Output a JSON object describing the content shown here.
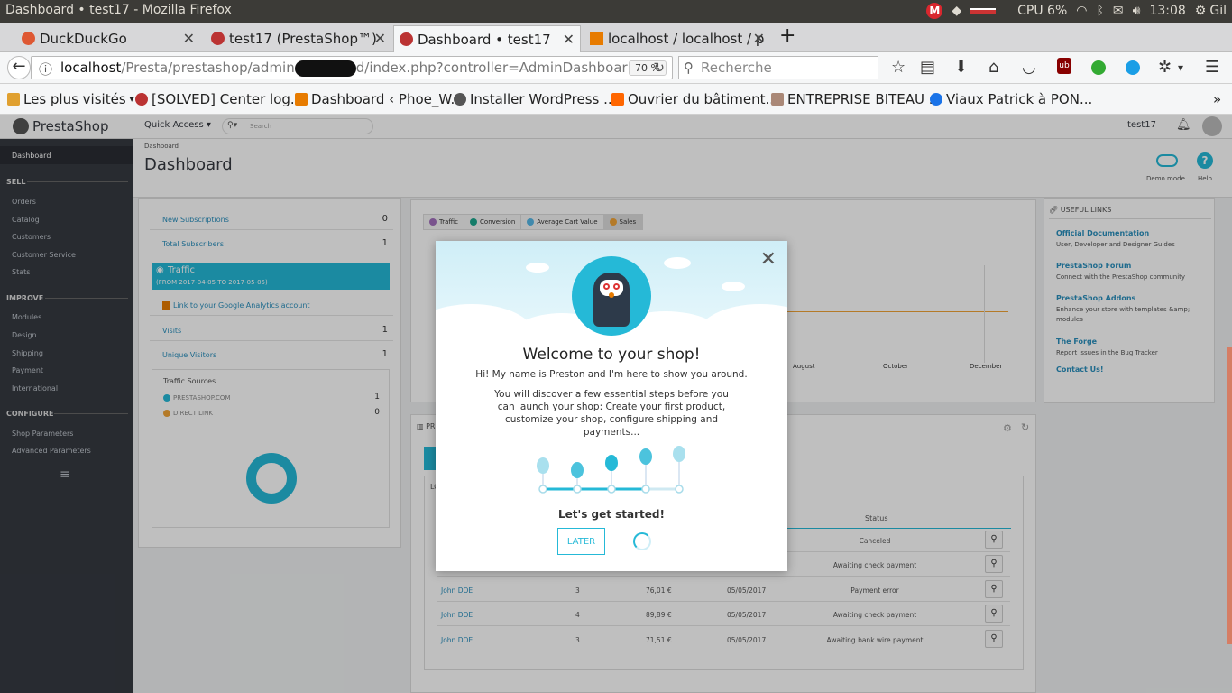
{
  "os": {
    "window_title": "Dashboard • test17 - Mozilla Firefox",
    "cpu": "CPU 6%",
    "clock": "13:08",
    "user": "Gil"
  },
  "tabs": [
    {
      "label": "DuckDuckGo",
      "favcolor": "#de5833"
    },
    {
      "label": "test17 (PrestaShop™)",
      "favcolor": "#b33"
    },
    {
      "label": "Dashboard • test17",
      "favcolor": "#b33"
    },
    {
      "label": "localhost / localhost / p",
      "favcolor": "#e77b00"
    }
  ],
  "nav": {
    "url_host": "localhost",
    "url_path": "/Presta/prestashop/admin",
    "url_tail": "d/index.php?controller=AdminDashboar",
    "zoom": "70 %",
    "search_placeholder": "Recherche"
  },
  "bookmarks": [
    {
      "label": "Les plus visités",
      "color": "#e0a030"
    },
    {
      "label": "[SOLVED] Center log...",
      "color": "#b33"
    },
    {
      "label": "Dashboard ‹ Phoe_W...",
      "color": "#e77b00"
    },
    {
      "label": "Installer WordPress ...",
      "color": "#555"
    },
    {
      "label": "Ouvrier du bâtiment...",
      "color": "#f60"
    },
    {
      "label": "ENTREPRISE BITEAU ...",
      "color": "#a87"
    },
    {
      "label": "Viaux Patrick à PON...",
      "color": "#1a73e8"
    }
  ],
  "ps": {
    "logo": "PrestaShop",
    "quick_access": "Quick Access",
    "search_placeholder": "Search",
    "user": "test17",
    "breadcrumb": "Dashboard",
    "page_title": "Dashboard",
    "demo_mode": "Demo mode",
    "help": "Help",
    "sidebar": {
      "dashboard": "Dashboard",
      "sell": "SELL",
      "sell_items": [
        "Orders",
        "Catalog",
        "Customers",
        "Customer Service",
        "Stats"
      ],
      "improve": "IMPROVE",
      "improve_items": [
        "Modules",
        "Design",
        "Shipping",
        "Payment",
        "International"
      ],
      "configure": "CONFIGURE",
      "configure_items": [
        "Shop Parameters",
        "Advanced Parameters"
      ]
    },
    "left_panel": {
      "new_subscriptions": "New Subscriptions",
      "new_subscriptions_val": "0",
      "total_subscribers": "Total Subscribers",
      "total_subscribers_val": "1",
      "traffic_title": "Traffic",
      "traffic_range": "(FROM 2017-04-05 TO 2017-05-05)",
      "ga_link": "Link to your Google Analytics account",
      "visits": "Visits",
      "visits_val": "1",
      "unique_visitors": "Unique Visitors",
      "unique_visitors_val": "1",
      "traffic_sources": "Traffic Sources",
      "src1": "PRESTASHOP.COM",
      "src1_val": "1",
      "src2": "DIRECT LINK",
      "src2_val": "0"
    },
    "chart_tabs": [
      "Traffic",
      "Conversion",
      "Average Cart Value",
      "Sales"
    ],
    "chart_tab_colors": [
      "#a26fbd",
      "#1ba68d",
      "#56b7e6",
      "#f0a336"
    ],
    "months": [
      "August",
      "October",
      "December"
    ],
    "useful_links": {
      "title": "USEFUL LINKS",
      "items": [
        {
          "title": "Official Documentation",
          "desc": "User, Developer and Designer Guides"
        },
        {
          "title": "PrestaShop Forum",
          "desc": "Connect with the PrestaShop community"
        },
        {
          "title": "PrestaShop Addons",
          "desc": "Enhance your store with templates &amp; modules"
        },
        {
          "title": "The Forge",
          "desc": "Report issues in the Bug Tracker"
        },
        {
          "title": "Contact Us!",
          "desc": ""
        }
      ]
    },
    "products_panel_label": "PR",
    "orders_label": "LO",
    "status_header": "Status",
    "orders": [
      {
        "customer": "",
        "qty": "",
        "total": "",
        "date": "",
        "status": "Canceled"
      },
      {
        "customer": "",
        "qty": "",
        "total": "",
        "date": "",
        "status": "Awaiting check payment"
      },
      {
        "customer": "John DOE",
        "qty": "3",
        "total": "76,01 €",
        "date": "05/05/2017",
        "status": "Payment error"
      },
      {
        "customer": "John DOE",
        "qty": "4",
        "total": "89,89 €",
        "date": "05/05/2017",
        "status": "Awaiting check payment"
      },
      {
        "customer": "John DOE",
        "qty": "3",
        "total": "71,51 €",
        "date": "05/05/2017",
        "status": "Awaiting bank wire payment"
      }
    ]
  },
  "modal": {
    "title": "Welcome to your shop!",
    "intro": "Hi! My name is Preston and I'm here to show you around.",
    "desc": "You will discover a few essential steps before you can launch your shop: Create your first product, customize your shop, configure shipping and payments...",
    "cta": "Let's get started!",
    "later": "LATER"
  }
}
